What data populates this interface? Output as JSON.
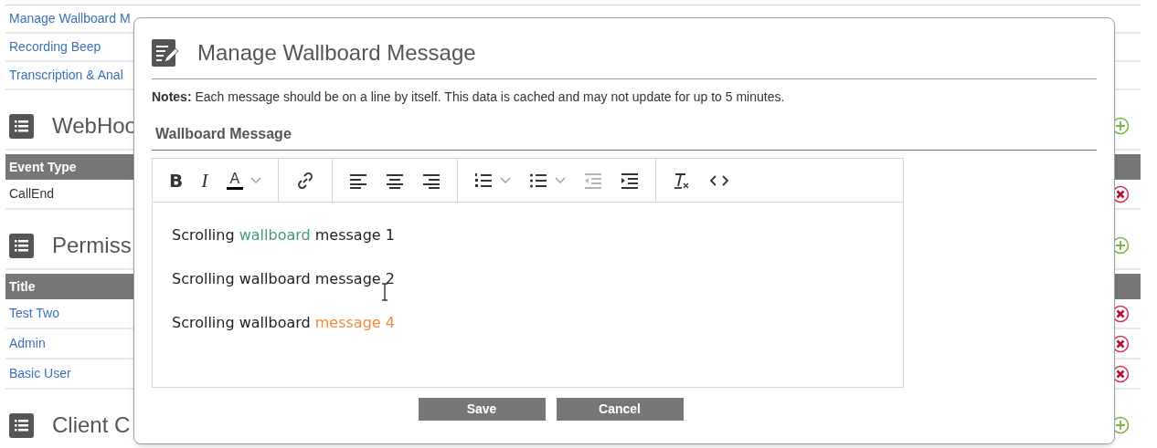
{
  "background": {
    "links": [
      {
        "text": "Manage Wallboard M"
      },
      {
        "text": "Recording Beep"
      },
      {
        "text": "Transcription & Anal"
      }
    ],
    "sections": [
      {
        "title": "WebHoo",
        "table": {
          "columns": [
            "Event Type"
          ],
          "rows": [
            {
              "text": "CallEnd",
              "kind": "text"
            }
          ]
        }
      },
      {
        "title": "Permiss",
        "table": {
          "columns": [
            "Title"
          ],
          "rows": [
            {
              "text": "Test Two",
              "kind": "link"
            },
            {
              "text": "Admin",
              "kind": "link"
            },
            {
              "text": "Basic User",
              "kind": "link"
            }
          ]
        }
      },
      {
        "title": "Client C"
      }
    ]
  },
  "dialog": {
    "title": "Manage Wallboard Message",
    "notes": "**Notes:** Each message should be on a line by itself. This data is cached and may not update for up to 5 minutes.",
    "field_label": "Wallboard Message",
    "toolbar": [
      [
        {
          "kind": "bold",
          "label": "B",
          "disabled": false
        },
        {
          "kind": "italic",
          "label": "I",
          "disabled": false
        },
        {
          "kind": "color",
          "label": "A",
          "disabled": false
        }
      ],
      [
        {
          "kind": "link",
          "disabled": false
        }
      ],
      [
        {
          "kind": "align-left",
          "disabled": false
        },
        {
          "kind": "align-center",
          "disabled": false
        },
        {
          "kind": "align-right",
          "disabled": false
        }
      ],
      [
        {
          "kind": "ordered-list",
          "disabled": false
        },
        {
          "kind": "bullet-list",
          "disabled": false
        },
        {
          "kind": "outdent",
          "disabled": true
        },
        {
          "kind": "indent",
          "disabled": false
        }
      ],
      [
        {
          "kind": "clear-format",
          "disabled": false
        },
        {
          "kind": "code",
          "disabled": false
        }
      ]
    ],
    "lines": [
      [
        {
          "text": "Scrolling "
        },
        {
          "text": "wallboard",
          "color": "#3f9a8a"
        },
        {
          "text": " message 1"
        }
      ],
      [
        {
          "text": "Scrolling wallboard message 2"
        }
      ],
      [
        {
          "text": "Scrolling wallboard "
        },
        {
          "text": "message 4",
          "color": "#ee8a3a"
        }
      ]
    ],
    "buttons": [
      "Save",
      "Cancel"
    ]
  }
}
